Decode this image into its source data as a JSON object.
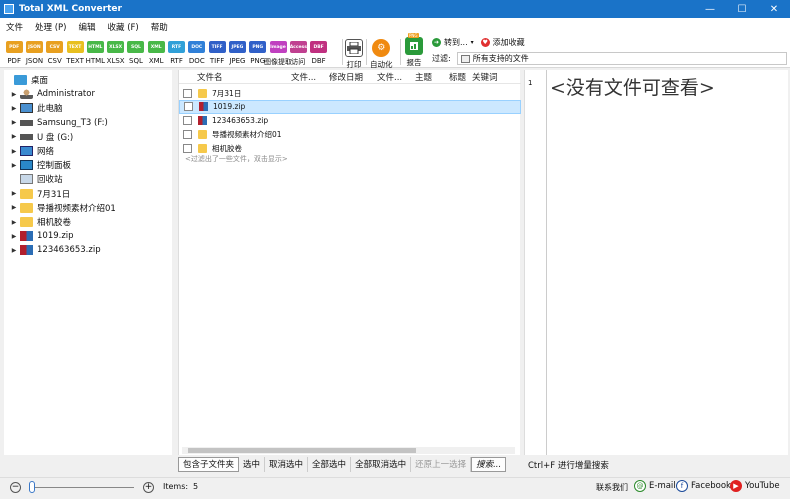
{
  "window": {
    "title": "Total XML Converter",
    "minimize": "—",
    "maximize": "☐",
    "close": "✕"
  },
  "menu": [
    "文件",
    "处理 (P)",
    "编辑",
    "收藏 (F)",
    "帮助"
  ],
  "toolbar": {
    "formats": [
      {
        "label": "PDF",
        "icon_text": "PDF",
        "color": "#e8a020"
      },
      {
        "label": "JSON",
        "icon_text": "JSON",
        "color": "#e8a020"
      },
      {
        "label": "CSV",
        "icon_text": "CSV",
        "color": "#e8a020"
      },
      {
        "label": "TEXT",
        "icon_text": "TEXT",
        "color": "#e8c020"
      },
      {
        "label": "HTML",
        "icon_text": "HTML",
        "color": "#48b848"
      },
      {
        "label": "XLSX",
        "icon_text": "XLSX",
        "color": "#48b848"
      },
      {
        "label": "SQL",
        "icon_text": "SQL",
        "color": "#48b848"
      },
      {
        "label": "XML",
        "icon_text": "XML",
        "color": "#48b848"
      },
      {
        "label": "RTF",
        "icon_text": "RTF",
        "color": "#30a0d8"
      },
      {
        "label": "DOC",
        "icon_text": "DOC",
        "color": "#3080d8"
      },
      {
        "label": "TIFF",
        "icon_text": "TIFF",
        "color": "#3060c8"
      },
      {
        "label": "JPEG",
        "icon_text": "JPEG",
        "color": "#3060c8"
      },
      {
        "label": "PNG",
        "icon_text": "PNG",
        "color": "#3060c8"
      },
      {
        "label": "图像提取",
        "icon_text": "Image",
        "color": "#c040c0"
      },
      {
        "label": "访问",
        "icon_text": "Access",
        "color": "#c04090"
      },
      {
        "label": "DBF",
        "icon_text": "DBF",
        "color": "#c03080"
      }
    ],
    "print_label": "打印",
    "auto_label": "自动化",
    "report_label": "报告",
    "report_badge": "PNG",
    "goto_label": "转到...",
    "favorite_label": "添加收藏",
    "filter_label": "过滤:",
    "filter_value": "所有支持的文件"
  },
  "tree": [
    {
      "label": "桌面",
      "icon": "desktop-icon",
      "level": 0,
      "arrow": ""
    },
    {
      "label": "Administrator",
      "icon": "user-icon",
      "level": 1,
      "arrow": "▶"
    },
    {
      "label": "此电脑",
      "icon": "computer-icon",
      "level": 1,
      "arrow": "▶"
    },
    {
      "label": "Samsung_T3 (F:)",
      "icon": "drive-icon",
      "level": 1,
      "arrow": "▶"
    },
    {
      "label": "U 盘 (G:)",
      "icon": "drive-icon",
      "level": 1,
      "arrow": "▶"
    },
    {
      "label": "网络",
      "icon": "network-icon",
      "level": 1,
      "arrow": "▶"
    },
    {
      "label": "控制面板",
      "icon": "control-panel-icon",
      "level": 1,
      "arrow": "▶"
    },
    {
      "label": "回收站",
      "icon": "recycle-bin-icon",
      "level": 1,
      "arrow": ""
    },
    {
      "label": "7月31日",
      "icon": "folder-icon",
      "level": 1,
      "arrow": "▶"
    },
    {
      "label": "导播视频素材介绍01",
      "icon": "folder-icon",
      "level": 1,
      "arrow": "▶"
    },
    {
      "label": "相机胶卷",
      "icon": "folder-icon",
      "level": 1,
      "arrow": "▶"
    },
    {
      "label": "1019.zip",
      "icon": "zip-icon",
      "level": 1,
      "arrow": "▶"
    },
    {
      "label": "123463653.zip",
      "icon": "zip-icon",
      "level": 1,
      "arrow": "▶"
    }
  ],
  "list": {
    "columns": [
      "文件名",
      "文件...",
      "修改日期",
      "文件...",
      "主题",
      "标题",
      "关键词"
    ],
    "rows": [
      {
        "name": "7月31日",
        "icon": "folder-icon",
        "selected": false
      },
      {
        "name": "1019.zip",
        "icon": "zip-icon",
        "selected": true
      },
      {
        "name": "123463653.zip",
        "icon": "zip-icon",
        "selected": false
      },
      {
        "name": "导播视频素材介绍01",
        "icon": "folder-icon",
        "selected": false
      },
      {
        "name": "相机胶卷",
        "icon": "folder-icon",
        "selected": false
      }
    ],
    "hint": "<过滤出了一些文件，双击显示>"
  },
  "editor": {
    "line_number": "1",
    "message": "<没有文件可查看>",
    "status": "Ctrl+F 进行增量搜索"
  },
  "bottom_buttons": [
    "包含子文件夹",
    "选中",
    "取消选中",
    "全部选中",
    "全部取消选中",
    "还原上一选择",
    "搜索..."
  ],
  "status": {
    "items_label": "Items:",
    "items_value": "5",
    "contact": "联系我们",
    "email": "E-mail",
    "facebook": "Facebook",
    "youtube": "YouTube",
    "zoom_level": 0.02
  },
  "colors": {
    "titlebar": "#1a73c8",
    "selection": "#cce8ff"
  }
}
